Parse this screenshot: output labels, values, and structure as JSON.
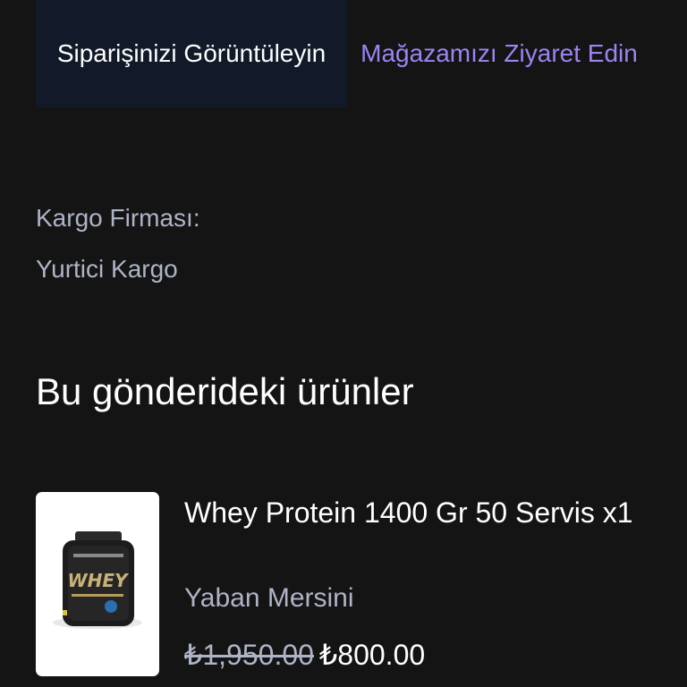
{
  "actions": {
    "view_order_label": "Siparişinizi Görüntüleyin",
    "visit_store_label": "Mağazamızı Ziyaret Edin"
  },
  "shipping": {
    "carrier_label": "Kargo Firması:",
    "carrier_value": "Yurtici Kargo"
  },
  "shipment_items": {
    "title": "Bu gönderideki ürünler",
    "items": [
      {
        "name": "Whey Protein 1400 Gr 50 Servis x1",
        "variant": "Yaban Mersini",
        "old_price": "₺1,950.00",
        "price": "₺800.00",
        "image_label": "WHEY"
      }
    ]
  },
  "colors": {
    "background": "#141414",
    "primary_button": "#121a2a",
    "link_accent": "#9d84f2",
    "muted_text": "#aeb4c7"
  }
}
